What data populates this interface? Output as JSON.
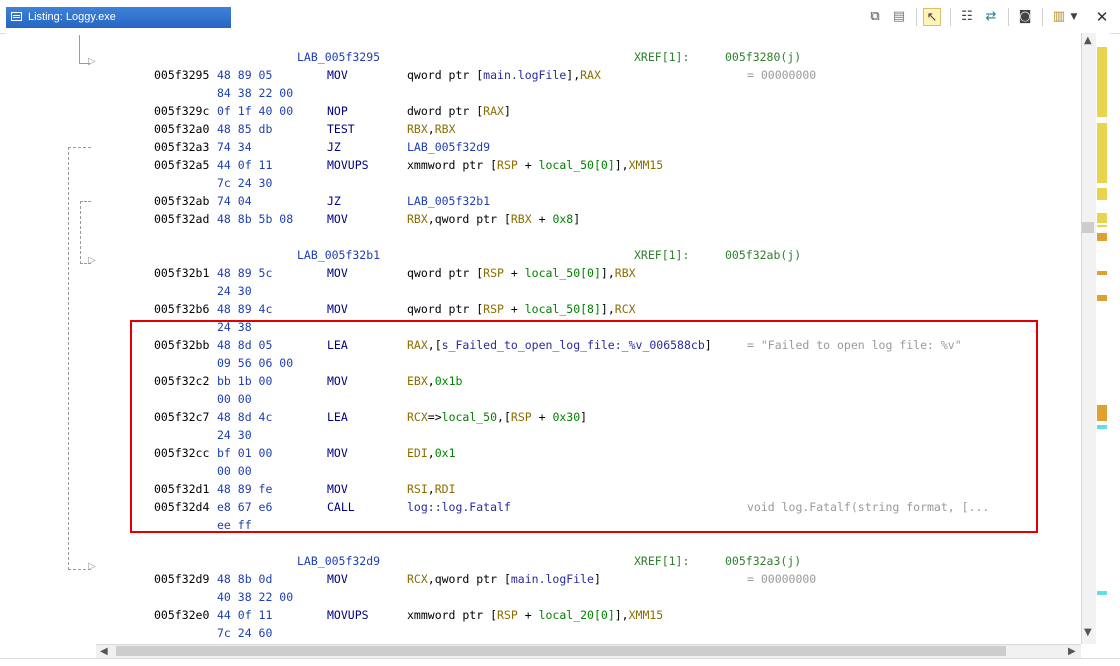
{
  "window": {
    "title": "Listing:  Loggy.exe",
    "close_glyph": "✕"
  },
  "toolbar_icons": [
    "copy-icon",
    "paste-icon",
    "cursor-select-icon",
    "field-layout-icon",
    "diff-icon",
    "snapshot-icon",
    "display-options-icon",
    "dropdown-icon"
  ],
  "listing": {
    "lines": [
      {
        "type": "label",
        "label": "LAB_005f3295",
        "xref_label": "XREF[1]:",
        "xref_target": "005f3280(j)"
      },
      {
        "type": "instr",
        "addr": "005f3295",
        "bytes": "48 89 05",
        "mnemonic": "MOV",
        "operands": [
          {
            "t": "qword ptr [",
            "c": "ops"
          },
          {
            "t": "main.logFile",
            "c": "sym"
          },
          {
            "t": "],",
            "c": "ops"
          },
          {
            "t": "RAX",
            "c": "reg"
          }
        ],
        "comment": "= 00000000"
      },
      {
        "type": "cont",
        "bytes": "84 38 22 00"
      },
      {
        "type": "instr",
        "addr": "005f329c",
        "bytes": "0f 1f 40 00",
        "mnemonic": "NOP",
        "operands": [
          {
            "t": "dword ptr [",
            "c": "ops"
          },
          {
            "t": "RAX",
            "c": "reg"
          },
          {
            "t": "]",
            "c": "ops"
          }
        ],
        "comment": ""
      },
      {
        "type": "instr",
        "addr": "005f32a0",
        "bytes": "48 85 db",
        "mnemonic": "TEST",
        "operands": [
          {
            "t": "RBX",
            "c": "reg"
          },
          {
            "t": ",",
            "c": "ops"
          },
          {
            "t": "RBX",
            "c": "reg"
          }
        ],
        "comment": ""
      },
      {
        "type": "instr",
        "addr": "005f32a3",
        "bytes": "74 34",
        "mnemonic": "JZ",
        "operands": [
          {
            "t": "LAB_005f32d9",
            "c": "lbl"
          }
        ],
        "comment": ""
      },
      {
        "type": "instr",
        "addr": "005f32a5",
        "bytes": "44 0f 11",
        "mnemonic": "MOVUPS",
        "operands": [
          {
            "t": "xmmword ptr [",
            "c": "ops"
          },
          {
            "t": "RSP",
            "c": "reg"
          },
          {
            "t": " + ",
            "c": "ops"
          },
          {
            "t": "local_50[0]",
            "c": "num"
          },
          {
            "t": "],",
            "c": "ops"
          },
          {
            "t": "XMM15",
            "c": "reg"
          }
        ],
        "comment": ""
      },
      {
        "type": "cont",
        "bytes": "7c 24 30"
      },
      {
        "type": "instr",
        "addr": "005f32ab",
        "bytes": "74 04",
        "mnemonic": "JZ",
        "operands": [
          {
            "t": "LAB_005f32b1",
            "c": "lbl"
          }
        ],
        "comment": ""
      },
      {
        "type": "instr",
        "addr": "005f32ad",
        "bytes": "48 8b 5b 08",
        "mnemonic": "MOV",
        "operands": [
          {
            "t": "RBX",
            "c": "reg"
          },
          {
            "t": ",qword ptr [",
            "c": "ops"
          },
          {
            "t": "RBX",
            "c": "reg"
          },
          {
            "t": " + ",
            "c": "ops"
          },
          {
            "t": "0x8",
            "c": "num"
          },
          {
            "t": "]",
            "c": "ops"
          }
        ],
        "comment": ""
      },
      {
        "type": "blank"
      },
      {
        "type": "label",
        "label": "LAB_005f32b1",
        "xref_label": "XREF[1]:",
        "xref_target": "005f32ab(j)"
      },
      {
        "type": "instr",
        "addr": "005f32b1",
        "bytes": "48 89 5c",
        "mnemonic": "MOV",
        "operands": [
          {
            "t": "qword ptr [",
            "c": "ops"
          },
          {
            "t": "RSP",
            "c": "reg"
          },
          {
            "t": " + ",
            "c": "ops"
          },
          {
            "t": "local_50[0]",
            "c": "num"
          },
          {
            "t": "],",
            "c": "ops"
          },
          {
            "t": "RBX",
            "c": "reg"
          }
        ],
        "comment": ""
      },
      {
        "type": "cont",
        "bytes": "24 30"
      },
      {
        "type": "instr",
        "addr": "005f32b6",
        "bytes": "48 89 4c",
        "mnemonic": "MOV",
        "operands": [
          {
            "t": "qword ptr [",
            "c": "ops"
          },
          {
            "t": "RSP",
            "c": "reg"
          },
          {
            "t": " + ",
            "c": "ops"
          },
          {
            "t": "local_50[8]",
            "c": "num"
          },
          {
            "t": "],",
            "c": "ops"
          },
          {
            "t": "RCX",
            "c": "reg"
          }
        ],
        "comment": ""
      },
      {
        "type": "cont",
        "bytes": "24 38"
      },
      {
        "type": "instr",
        "addr": "005f32bb",
        "bytes": "48 8d 05",
        "mnemonic": "LEA",
        "operands": [
          {
            "t": "RAX",
            "c": "reg"
          },
          {
            "t": ",[",
            "c": "ops"
          },
          {
            "t": "s_Failed_to_open_log_file:_%v_006588cb",
            "c": "sym"
          },
          {
            "t": "]",
            "c": "ops"
          }
        ],
        "comment": "= \"Failed to open log file: %v\""
      },
      {
        "type": "cont",
        "bytes": "09 56 06 00"
      },
      {
        "type": "instr",
        "addr": "005f32c2",
        "bytes": "bb 1b 00",
        "mnemonic": "MOV",
        "operands": [
          {
            "t": "EBX",
            "c": "reg"
          },
          {
            "t": ",",
            "c": "ops"
          },
          {
            "t": "0x1b",
            "c": "num"
          }
        ],
        "comment": ""
      },
      {
        "type": "cont",
        "bytes": "00 00"
      },
      {
        "type": "instr",
        "addr": "005f32c7",
        "bytes": "48 8d 4c",
        "mnemonic": "LEA",
        "operands": [
          {
            "t": "RCX",
            "c": "reg"
          },
          {
            "t": "=>",
            "c": "ops"
          },
          {
            "t": "local_50",
            "c": "num"
          },
          {
            "t": ",[",
            "c": "ops"
          },
          {
            "t": "RSP",
            "c": "reg"
          },
          {
            "t": " + ",
            "c": "ops"
          },
          {
            "t": "0x30",
            "c": "num"
          },
          {
            "t": "]",
            "c": "ops"
          }
        ],
        "comment": ""
      },
      {
        "type": "cont",
        "bytes": "24 30"
      },
      {
        "type": "instr",
        "addr": "005f32cc",
        "bytes": "bf 01 00",
        "mnemonic": "MOV",
        "operands": [
          {
            "t": "EDI",
            "c": "reg"
          },
          {
            "t": ",",
            "c": "ops"
          },
          {
            "t": "0x1",
            "c": "num"
          }
        ],
        "comment": ""
      },
      {
        "type": "cont",
        "bytes": "00 00"
      },
      {
        "type": "instr",
        "addr": "005f32d1",
        "bytes": "48 89 fe",
        "mnemonic": "MOV",
        "operands": [
          {
            "t": "RSI",
            "c": "reg"
          },
          {
            "t": ",",
            "c": "ops"
          },
          {
            "t": "RDI",
            "c": "reg"
          }
        ],
        "comment": ""
      },
      {
        "type": "instr",
        "addr": "005f32d4",
        "bytes": "e8 67 e6",
        "mnemonic": "CALL",
        "operands": [
          {
            "t": "log::log.Fatalf",
            "c": "sym"
          }
        ],
        "comment": "void log.Fatalf(string format, [..."
      },
      {
        "type": "cont",
        "bytes": "ee ff"
      },
      {
        "type": "blank"
      },
      {
        "type": "label",
        "label": "LAB_005f32d9",
        "xref_label": "XREF[1]:",
        "xref_target": "005f32a3(j)"
      },
      {
        "type": "instr",
        "addr": "005f32d9",
        "bytes": "48 8b 0d",
        "mnemonic": "MOV",
        "operands": [
          {
            "t": "RCX",
            "c": "reg"
          },
          {
            "t": ",qword ptr [",
            "c": "ops"
          },
          {
            "t": "main.logFile",
            "c": "sym"
          },
          {
            "t": "]",
            "c": "ops"
          }
        ],
        "comment": "= 00000000"
      },
      {
        "type": "cont",
        "bytes": "40 38 22 00"
      },
      {
        "type": "instr",
        "addr": "005f32e0",
        "bytes": "44 0f 11",
        "mnemonic": "MOVUPS",
        "operands": [
          {
            "t": "xmmword ptr [",
            "c": "ops"
          },
          {
            "t": "RSP",
            "c": "reg"
          },
          {
            "t": " + ",
            "c": "ops"
          },
          {
            "t": "local_20[0]",
            "c": "num"
          },
          {
            "t": "],",
            "c": "ops"
          },
          {
            "t": "XMM15",
            "c": "reg"
          }
        ],
        "comment": ""
      },
      {
        "type": "cont",
        "bytes": "7c 24 60"
      }
    ]
  },
  "colors": {
    "title_bar": "#2f72d0",
    "highlight_border": "#e00000",
    "overview_yellow": "#e8d44d",
    "overview_orange": "#e0a030",
    "overview_cyan": "#5fe0e8"
  }
}
